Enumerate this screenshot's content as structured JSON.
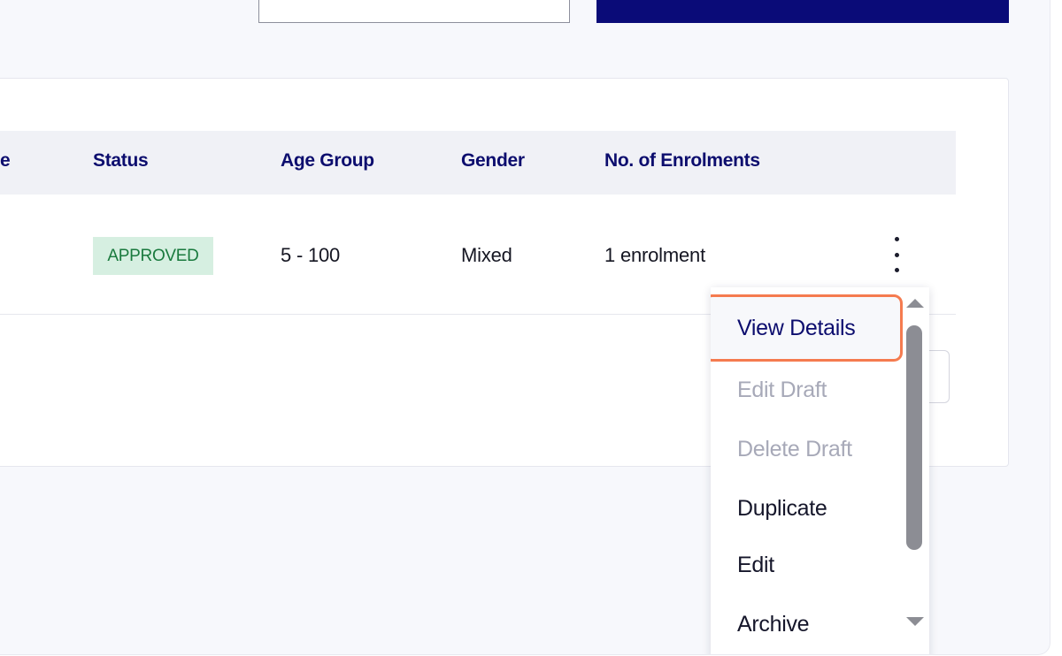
{
  "table": {
    "columns": {
      "partial": "e",
      "status": "Status",
      "age_group": "Age Group",
      "gender": "Gender",
      "enrolments": "No. of Enrolments"
    },
    "row": {
      "status": "APPROVED",
      "age_group": "5 - 100",
      "gender": "Mixed",
      "enrolments": "1 enrolment"
    }
  },
  "menu": {
    "items": [
      {
        "label": "View Details",
        "state": "highlighted"
      },
      {
        "label": "Edit Draft",
        "state": "disabled"
      },
      {
        "label": "Delete Draft",
        "state": "disabled"
      },
      {
        "label": "Duplicate",
        "state": "enabled"
      },
      {
        "label": "Edit",
        "state": "enabled"
      },
      {
        "label": "Archive",
        "state": "enabled"
      }
    ]
  },
  "colors": {
    "primary": "#0a0b78",
    "header_text": "#0c0d6e",
    "badge_bg": "#d6efe1",
    "badge_text": "#1a7a3e",
    "highlight_border": "#f57b4f"
  },
  "icons": {
    "row_actions": "kebab-vertical-icon",
    "scroll_up": "triangle-up-icon",
    "scroll_down": "triangle-down-icon"
  }
}
